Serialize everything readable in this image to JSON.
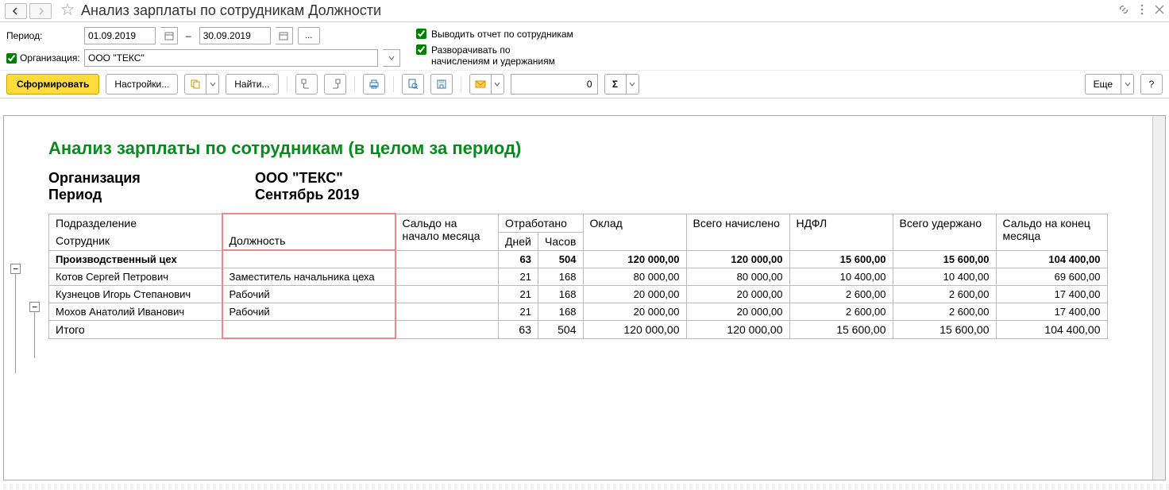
{
  "title": "Анализ зарплаты по сотрудникам Должности",
  "filters": {
    "period_label": "Период:",
    "date_from": "01.09.2019",
    "date_to": "30.09.2019",
    "org_checkbox_label": "Организация:",
    "org_value": "ООО \"ТЕКС\"",
    "check_by_employees": "Выводить отчет по сотрудникам",
    "check_expand_line1": "Разворачивать по",
    "check_expand_line2": "начислениям и удержаниям"
  },
  "toolbar": {
    "generate": "Сформировать",
    "settings": "Настройки...",
    "find": "Найти...",
    "num_value": "0",
    "more": "Еще",
    "help": "?"
  },
  "report": {
    "title": "Анализ зарплаты по сотрудникам (в целом за период)",
    "meta": {
      "org_label": "Организация",
      "org_value": "ООО \"ТЕКС\"",
      "period_label": "Период",
      "period_value": "Сентябрь 2019"
    },
    "headers": {
      "subdivision": "Подразделение",
      "employee": "Сотрудник",
      "position": "Должность",
      "balance_start": "Сальдо на начало месяца",
      "worked": "Отработано",
      "days": "Дней",
      "hours": "Часов",
      "salary": "Оклад",
      "accrued": "Всего начислено",
      "ndfl": "НДФЛ",
      "withheld": "Всего удержано",
      "balance_end": "Сальдо на конец месяца"
    },
    "group_row": {
      "name": "Производственный цех",
      "days": "63",
      "hours": "504",
      "salary": "120 000,00",
      "accrued": "120 000,00",
      "ndfl": "15 600,00",
      "withheld": "15 600,00",
      "balance_end": "104 400,00"
    },
    "rows": [
      {
        "name": "Котов Сергей Петрович",
        "position": "Заместитель начальника цеха",
        "days": "21",
        "hours": "168",
        "salary": "80 000,00",
        "accrued": "80 000,00",
        "ndfl": "10 400,00",
        "withheld": "10 400,00",
        "balance_end": "69 600,00"
      },
      {
        "name": "Кузнецов Игорь Степанович",
        "position": "Рабочий",
        "days": "21",
        "hours": "168",
        "salary": "20 000,00",
        "accrued": "20 000,00",
        "ndfl": "2 600,00",
        "withheld": "2 600,00",
        "balance_end": "17 400,00"
      },
      {
        "name": "Мохов Анатолий Иванович",
        "position": "Рабочий",
        "days": "21",
        "hours": "168",
        "salary": "20 000,00",
        "accrued": "20 000,00",
        "ndfl": "2 600,00",
        "withheld": "2 600,00",
        "balance_end": "17 400,00"
      }
    ],
    "total": {
      "label": "Итого",
      "days": "63",
      "hours": "504",
      "salary": "120 000,00",
      "accrued": "120 000,00",
      "ndfl": "15 600,00",
      "withheld": "15 600,00",
      "balance_end": "104 400,00"
    }
  }
}
